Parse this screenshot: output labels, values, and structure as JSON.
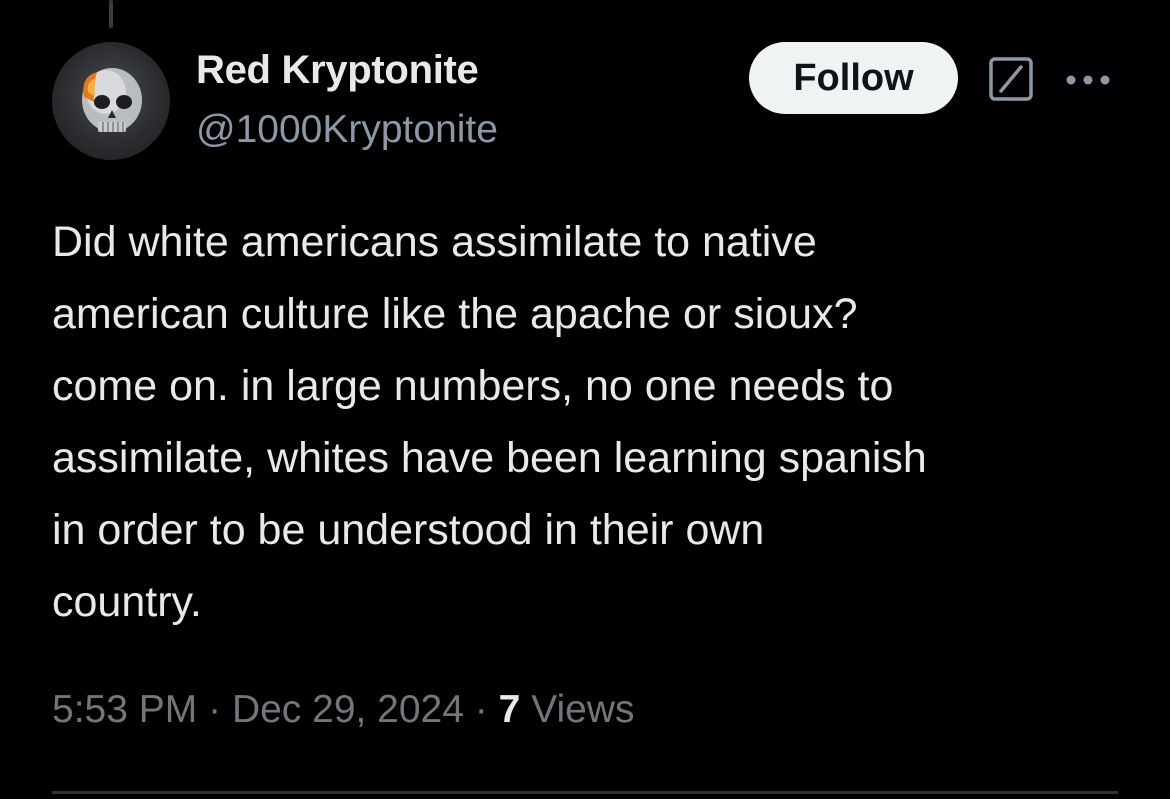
{
  "author": {
    "display_name": "Red Kryptonite",
    "handle": "@1000Kryptonite",
    "avatar_icon": "skull-avatar"
  },
  "actions": {
    "follow_label": "Follow",
    "grok_icon": "grok-icon",
    "more_icon": "more-icon"
  },
  "tweet": {
    "text": "Did white americans assimilate to native\namerican culture like the apache or sioux?\ncome on. in large numbers, no one needs to\nassimilate, whites have been learning spanish\nin order to be understood in their own\ncountry.",
    "time": "5:53 PM",
    "separator": "·",
    "date": "Dec 29, 2024",
    "views_count": "7",
    "views_label": "Views"
  },
  "colors": {
    "background": "#000000",
    "primary_text": "#e7e9ea",
    "secondary_text": "#71767b",
    "follow_button_bg": "#eff3f4"
  }
}
